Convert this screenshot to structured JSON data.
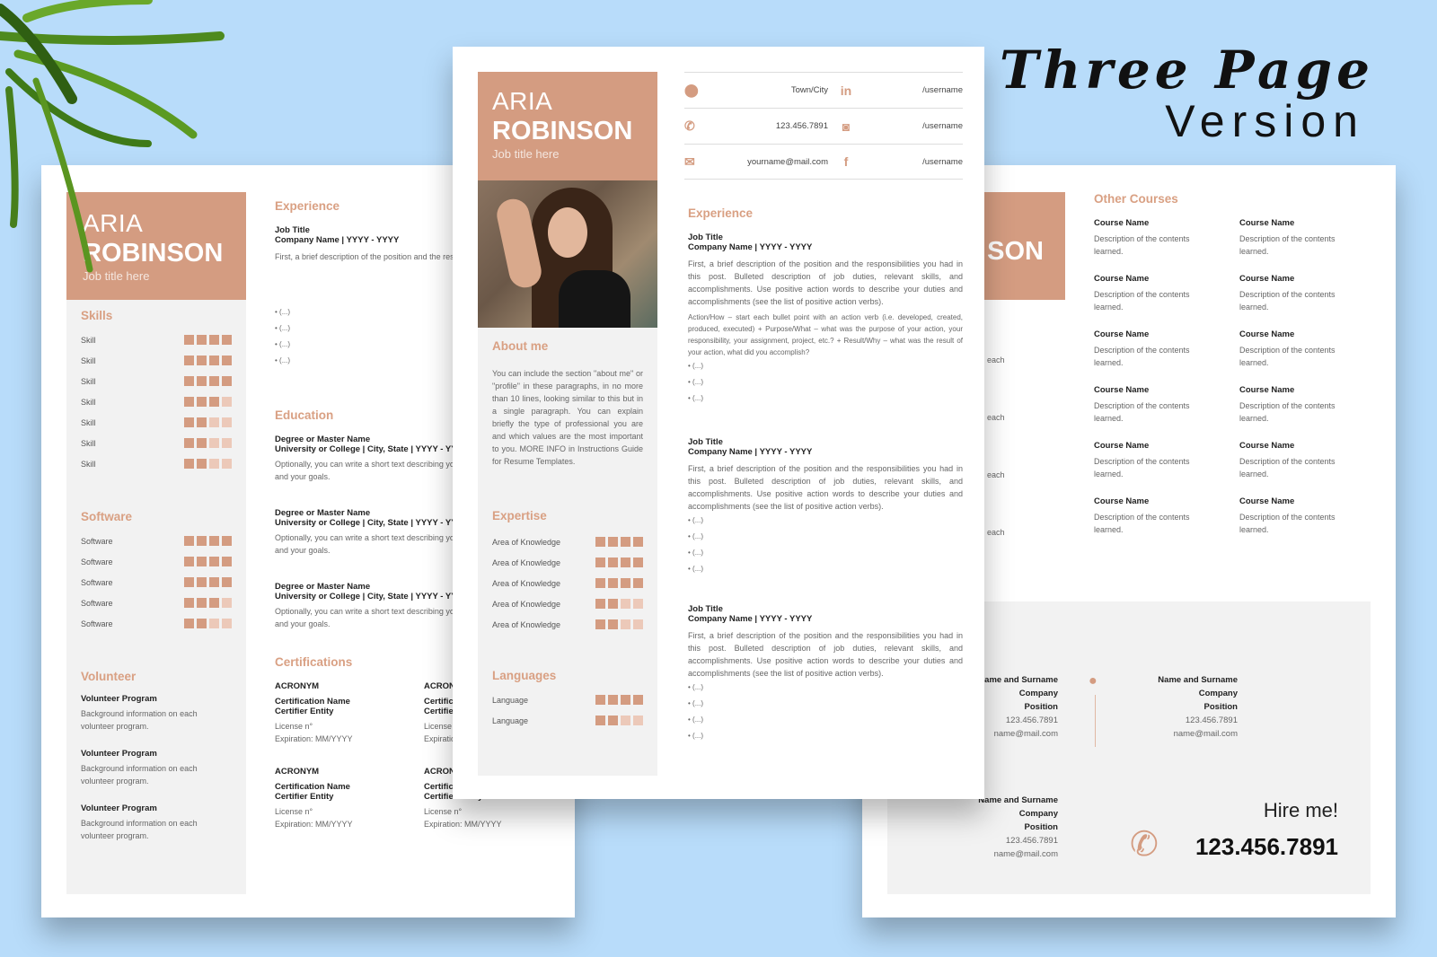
{
  "banner": {
    "line1": "Three Page",
    "line2": "Version"
  },
  "resume": {
    "first_name": "ARIA",
    "last_name": "ROBINSON",
    "job_title": "Job title here"
  },
  "contacts": [
    {
      "icon": "location-pin-icon",
      "value": "Town/City",
      "social_icon": "linkedin-icon",
      "social_glyph": "in",
      "social": "/username"
    },
    {
      "icon": "phone-icon",
      "value": "123.456.7891",
      "social_icon": "instagram-icon",
      "social_glyph": "◙",
      "social": "/username"
    },
    {
      "icon": "mail-icon",
      "value": "yourname@mail.com",
      "social_icon": "facebook-icon",
      "social_glyph": "f",
      "social": "/username"
    }
  ],
  "sections": {
    "experience": "Experience",
    "education": "Education",
    "certifications": "Certifications",
    "skills": "Skills",
    "software": "Software",
    "volunteer": "Volunteer",
    "about": "About me",
    "expertise": "Expertise",
    "languages": "Languages",
    "courses": "Other Courses"
  },
  "job": {
    "title": "Job Title",
    "company": "Company Name | YYYY - YYYY",
    "desc": "First, a brief description of the position and the responsibilities you had in this post. Bulleted description of job duties, relevant skills, and accomplishments. Use positive action words to describe your duties and accomplishments (see the list of positive action verbs).",
    "action": "Action/How – start each bullet point with an action verb (i.e. developed, created, produced, executed) + Purpose/What – what was the purpose of your action, your responsibility, your assignment, project, etc.? + Result/Why – what was the result of your action, what did you accomplish?",
    "bullet": "(...)"
  },
  "education": {
    "degree": "Degree or Master Name",
    "school": "University or College | City, State | YYYY - YYYY",
    "desc": "Optionally, you can write a short text describing your experience and your goals."
  },
  "cert": {
    "acronym": "ACRONYM",
    "name": "Certification Name",
    "entity": "Certifier Entity",
    "license": "License n°",
    "expiration": "Expiration: MM/YYYY"
  },
  "skills": [
    {
      "label": "Skill",
      "level": 4
    },
    {
      "label": "Skill",
      "level": 4
    },
    {
      "label": "Skill",
      "level": 4
    },
    {
      "label": "Skill",
      "level": 3
    },
    {
      "label": "Skill",
      "level": 2
    },
    {
      "label": "Skill",
      "level": 2
    },
    {
      "label": "Skill",
      "level": 2
    }
  ],
  "software": [
    {
      "label": "Software",
      "level": 4
    },
    {
      "label": "Software",
      "level": 4
    },
    {
      "label": "Software",
      "level": 4
    },
    {
      "label": "Software",
      "level": 3
    },
    {
      "label": "Software",
      "level": 2
    }
  ],
  "volunteer": {
    "program": "Volunteer Program",
    "desc": "Background information on each volunteer program."
  },
  "about": "You can include the section \"about me\" or \"profile\" in these paragraphs, in no more than 10 lines, looking similar to this but in a single paragraph. You can explain briefly the type of professional you are and which values are the most important to you. MORE INFO in Instructions Guide for Resume Templates.",
  "expertise": [
    {
      "label": "Area of Knowledge",
      "level": 4
    },
    {
      "label": "Area of Knowledge",
      "level": 4
    },
    {
      "label": "Area of Knowledge",
      "level": 4
    },
    {
      "label": "Area of Knowledge",
      "level": 2
    },
    {
      "label": "Area of Knowledge",
      "level": 2
    }
  ],
  "languages": [
    {
      "label": "Language",
      "level": 4
    },
    {
      "label": "Language",
      "level": 2
    }
  ],
  "course": {
    "name": "Course Name",
    "desc": "Description of the contents learned."
  },
  "reference": {
    "name": "Name and Surname",
    "company": "Company",
    "position": "Position",
    "phone": "123.456.7891",
    "email": "name@mail.com"
  },
  "hire": {
    "label": "Hire me!",
    "phone": "123.456.7891"
  },
  "colors": {
    "accent": "#d49c81",
    "accent_light": "#ecc9b9",
    "background": "#b8dcfa",
    "panel": "#f2f2f2"
  }
}
